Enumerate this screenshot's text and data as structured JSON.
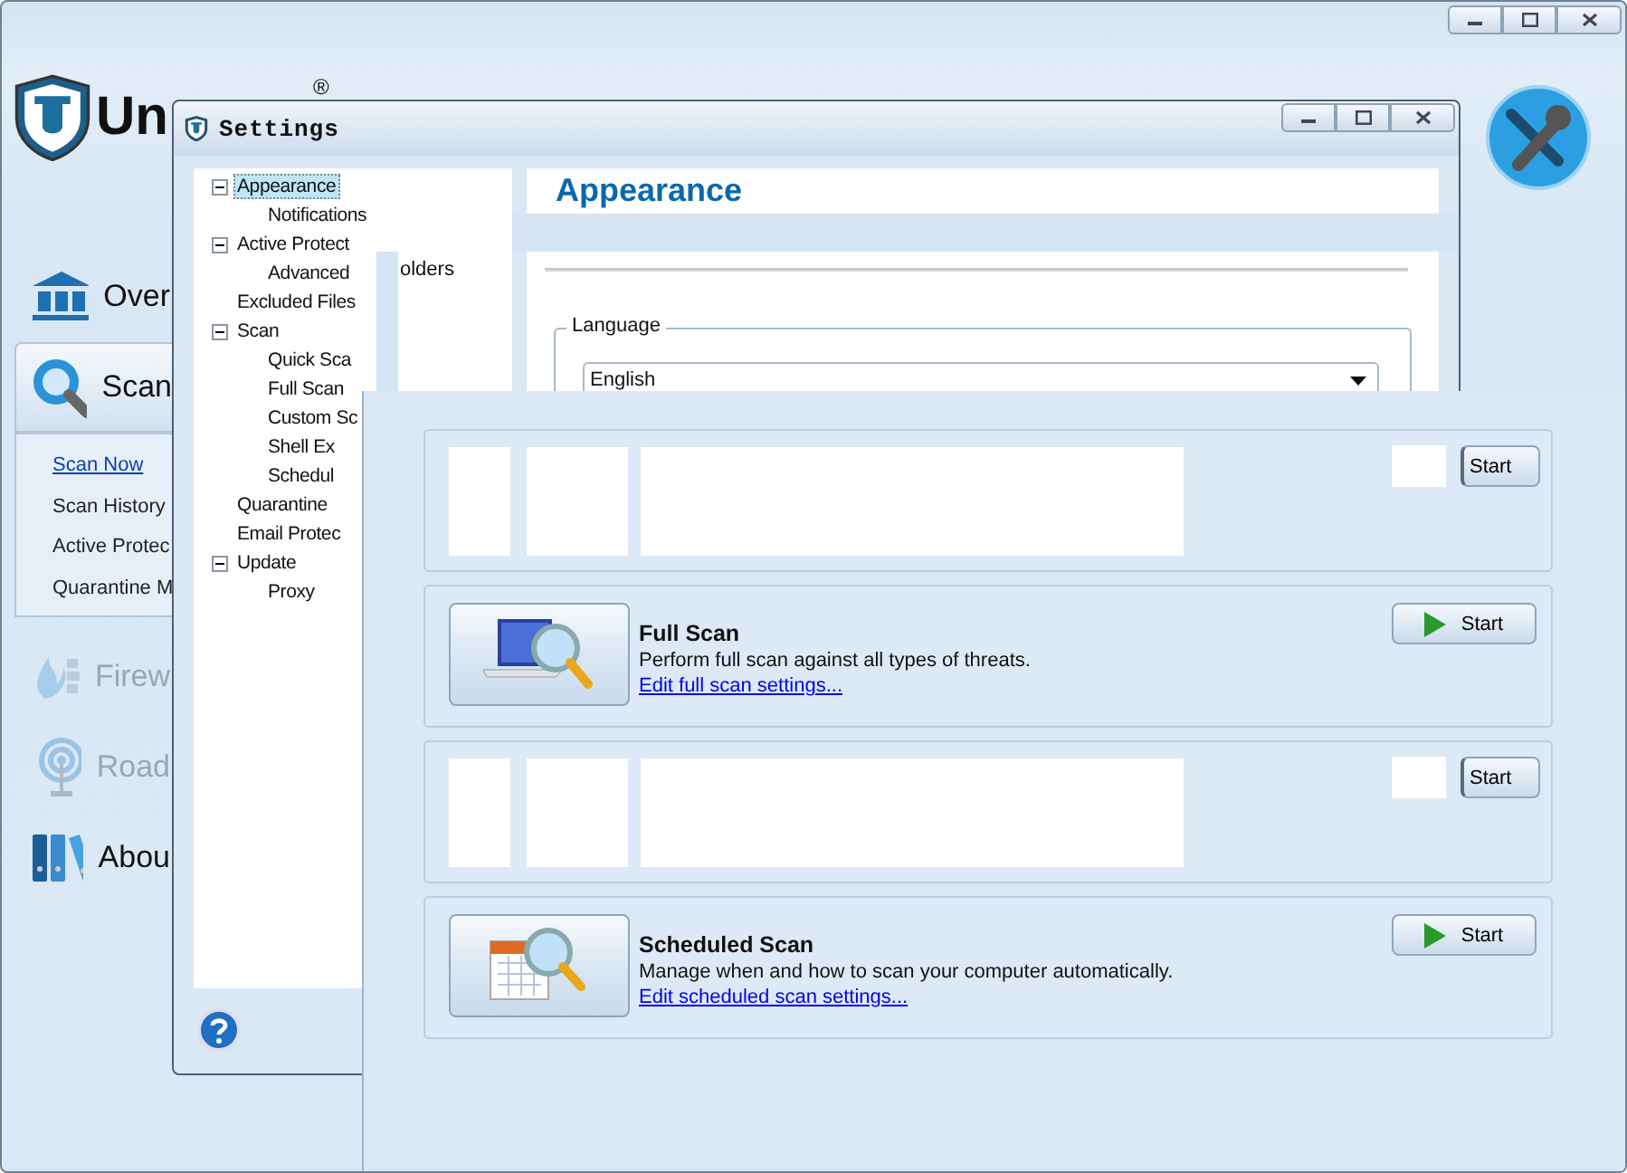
{
  "logo": {
    "text": "Un",
    "mark": "®"
  },
  "nav": [
    {
      "label": "Over",
      "selected": false,
      "disabled": false
    },
    {
      "label": "Scan",
      "selected": true,
      "disabled": false,
      "children": [
        {
          "label": "Scan Now",
          "selected": true
        },
        {
          "label": "Scan History",
          "selected": false
        },
        {
          "label": "Active Protec",
          "selected": false
        },
        {
          "label": "Quarantine M",
          "selected": false
        }
      ]
    },
    {
      "label": "Firew",
      "selected": false,
      "disabled": true
    },
    {
      "label": "Road",
      "selected": false,
      "disabled": true
    },
    {
      "label": "Abou",
      "selected": false,
      "disabled": false
    }
  ],
  "settings": {
    "title": "Settings",
    "tree": [
      {
        "label": "Appearance",
        "selected": true,
        "expanded": true,
        "children": [
          {
            "label": "Notifications",
            "selected": false
          }
        ]
      },
      {
        "label": "Active Protect",
        "selected": false,
        "expanded": true,
        "children": [
          {
            "label": "Advanced",
            "selected": false
          }
        ]
      },
      {
        "label": "Excluded Files",
        "selected": false
      },
      {
        "label": "Scan",
        "selected": false,
        "expanded": true,
        "children": [
          {
            "label": "Quick Sca",
            "selected": false
          },
          {
            "label": "Full Scan",
            "selected": false
          },
          {
            "label": "Custom Sc",
            "selected": false
          },
          {
            "label": "Shell Ex",
            "selected": false
          },
          {
            "label": "Schedul",
            "selected": false
          }
        ]
      },
      {
        "label": "Quarantine",
        "selected": false
      },
      {
        "label": "Email Protec",
        "selected": false
      },
      {
        "label": "Update",
        "selected": false,
        "expanded": true,
        "children": [
          {
            "label": "Proxy",
            "selected": false
          }
        ]
      }
    ],
    "tree_fragment": "olders",
    "heading": "Appearance",
    "language": {
      "legend": "Language",
      "value": "English"
    }
  },
  "scan_cards": [
    {
      "kind": "partial",
      "button": "Start"
    },
    {
      "kind": "full",
      "title": "Full Scan",
      "description": "Perform full scan against all types of threats.",
      "link": "Edit full scan settings...",
      "button": "Start"
    },
    {
      "kind": "partial",
      "button": "Start"
    },
    {
      "kind": "full",
      "title": "Scheduled Scan",
      "description": "Manage when and how to scan your computer automatically.",
      "link": "Edit scheduled scan settings...",
      "button": "Start"
    }
  ]
}
